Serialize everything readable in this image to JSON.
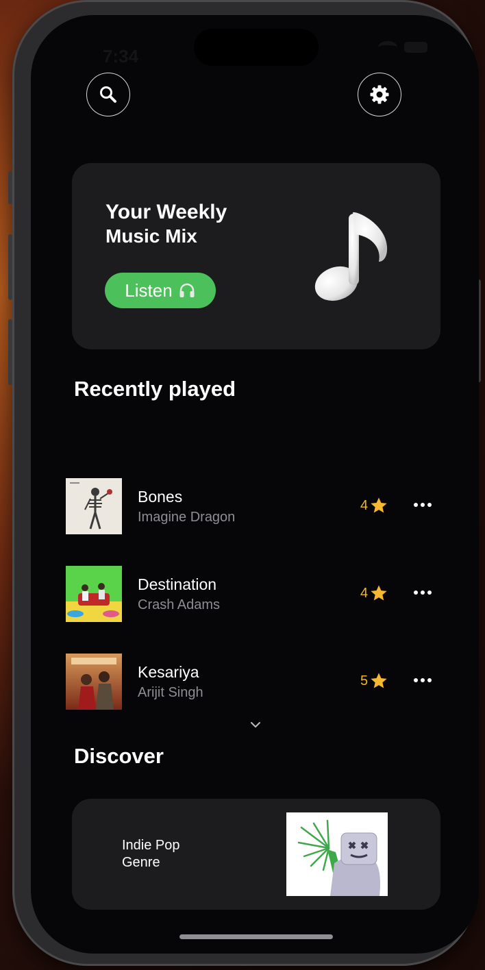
{
  "status_bar": {
    "time": "7:34"
  },
  "header": {
    "search_icon": "search-icon",
    "settings_icon": "gear-icon"
  },
  "hero": {
    "title_line1": "Your Weekly",
    "title_line2": "Music Mix",
    "listen_label": "Listen",
    "listen_icon": "headphones-icon",
    "accent": "#4cc05a"
  },
  "recently_played": {
    "title": "Recently played",
    "songs": [
      {
        "title": "Bones",
        "artist": "Imagine Dragon",
        "rating": "4"
      },
      {
        "title": "Destination",
        "artist": "Crash Adams",
        "rating": "4"
      },
      {
        "title": "Kesariya",
        "artist": "Arijit Singh",
        "rating": "5"
      }
    ],
    "rating_color": "#f2b52a"
  },
  "discover": {
    "title": "Discover",
    "card": {
      "line1": "Indie Pop",
      "line2": "Genre"
    }
  }
}
